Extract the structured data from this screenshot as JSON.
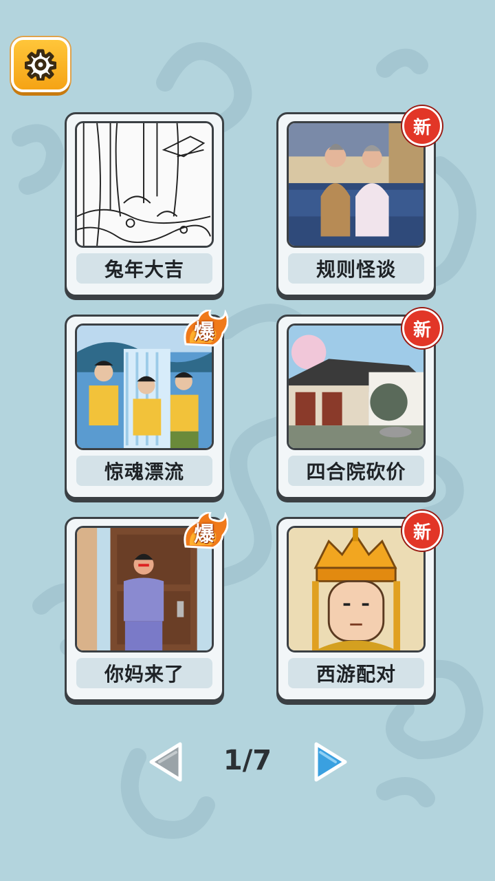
{
  "settings": {
    "icon": "gear-icon"
  },
  "levels": [
    {
      "label": "兔年大吉",
      "badge": null,
      "scene": "forest-sketch"
    },
    {
      "label": "规则怪谈",
      "badge": "新",
      "scene": "elderly-couple-sofa"
    },
    {
      "label": "惊魂漂流",
      "badge": "爆",
      "scene": "rafting-waterfall"
    },
    {
      "label": "四合院砍价",
      "badge": "新",
      "scene": "courtyard-house"
    },
    {
      "label": "你妈来了",
      "badge": "爆",
      "scene": "angry-mother-door"
    },
    {
      "label": "西游配对",
      "badge": "新",
      "scene": "monk-crown"
    }
  ],
  "pagination": {
    "current": "1/7",
    "prev_icon": "arrow-left-icon",
    "next_icon": "arrow-right-icon"
  },
  "colors": {
    "background": "#b3d4dd",
    "settings_button": "#f5a315",
    "badge_new": "#e23627",
    "badge_hot": "#f07a1a",
    "next_arrow": "#3aa0e0",
    "prev_arrow": "#9aa3a8"
  }
}
